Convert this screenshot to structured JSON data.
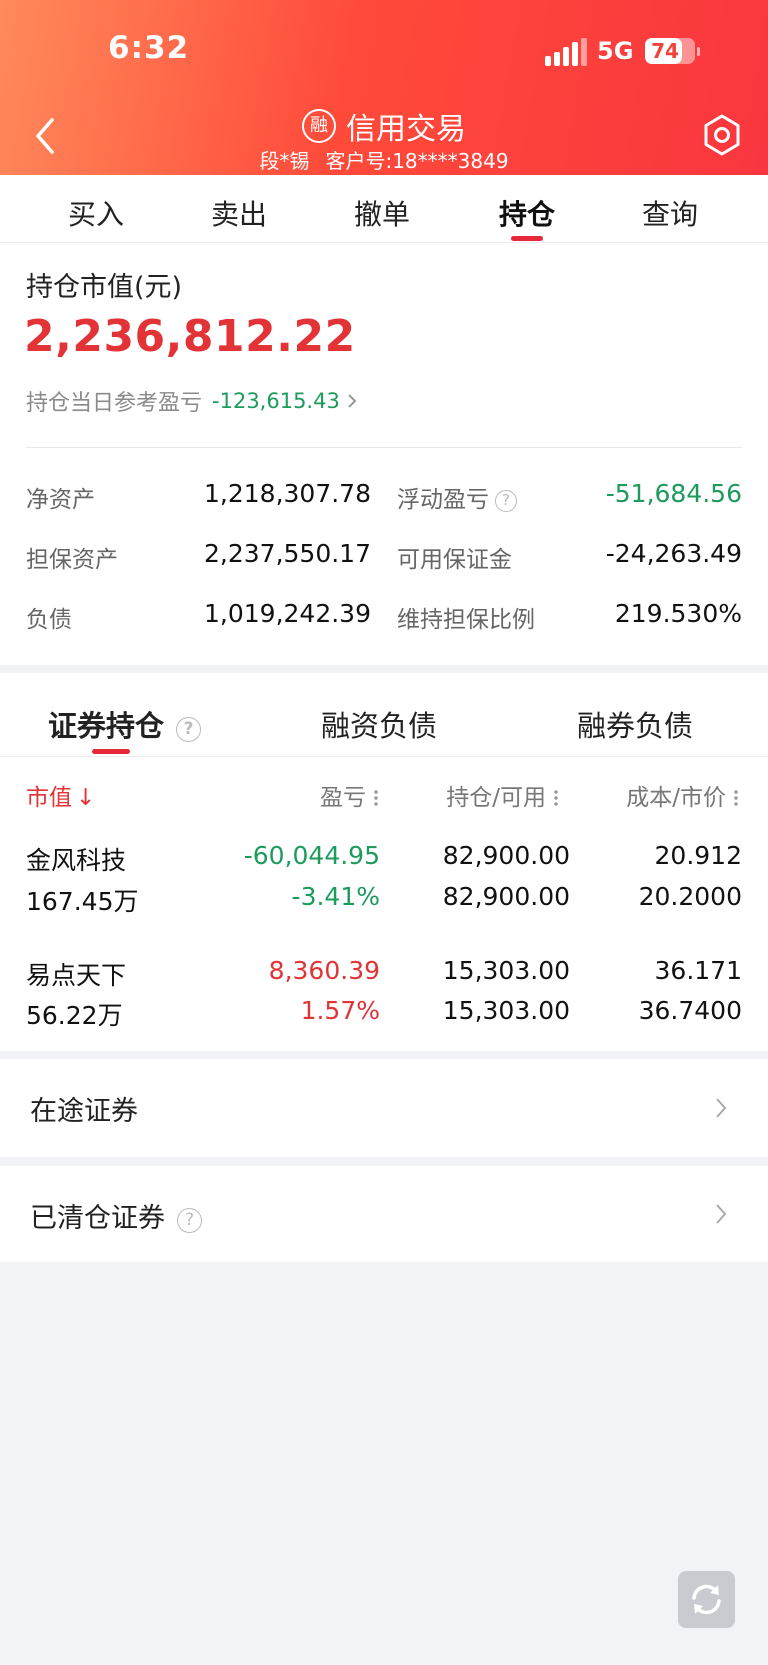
{
  "status_bar": {
    "time": "6:32",
    "network": "5G",
    "battery": "74",
    "battery_level": 0.74
  },
  "header": {
    "icon_text": "融",
    "title": "信用交易",
    "user": "段*锡",
    "client_no": "客户号:18****3849"
  },
  "tabs": [
    {
      "label": "买入"
    },
    {
      "label": "卖出"
    },
    {
      "label": "撤单"
    },
    {
      "label": "持仓"
    },
    {
      "label": "查询"
    }
  ],
  "summary": {
    "market_value_label": "持仓市值(元)",
    "market_value": "2,236,812.22",
    "daily_pnl_label": "持仓当日参考盈亏",
    "daily_pnl": "-123,615.43",
    "metrics": [
      {
        "label": "净资产",
        "value": "1,218,307.78"
      },
      {
        "label": "浮动盈亏",
        "value": "-51,684.56",
        "help": "?"
      },
      {
        "label": "担保资产",
        "value": "2,237,550.17"
      },
      {
        "label": "可用保证金",
        "value": "-24,263.49"
      },
      {
        "label": "负债",
        "value": "1,019,242.39"
      },
      {
        "label": "维持担保比例",
        "value": "219.530%"
      }
    ]
  },
  "positions": {
    "tabs": [
      {
        "label": "证券持仓",
        "help": "?"
      },
      {
        "label": "融资负债"
      },
      {
        "label": "融券负债"
      }
    ],
    "columns": [
      "市值",
      "盈亏",
      "持仓/可用",
      "成本/市价"
    ],
    "sort_arrow": "↓",
    "rows": [
      {
        "name": "金风科技",
        "market_value": "167.45万",
        "pnl": "-60,044.95",
        "pnl_pct": "-3.41%",
        "holding": "82,900.00",
        "available": "82,900.00",
        "cost": "20.912",
        "price": "20.2000"
      },
      {
        "name": "易点天下",
        "market_value": "56.22万",
        "pnl": "8,360.39",
        "pnl_pct": "1.57%",
        "holding": "15,303.00",
        "available": "15,303.00",
        "cost": "36.171",
        "price": "36.7400"
      }
    ]
  },
  "links": [
    {
      "label": "在途证券"
    },
    {
      "label": "已清仓证券",
      "help": "?"
    }
  ],
  "colors": {
    "header_start": "#ff8a5b",
    "header_end": "#f9363f",
    "accent_red": "#e23336",
    "gain_green": "#1c9b5d"
  }
}
